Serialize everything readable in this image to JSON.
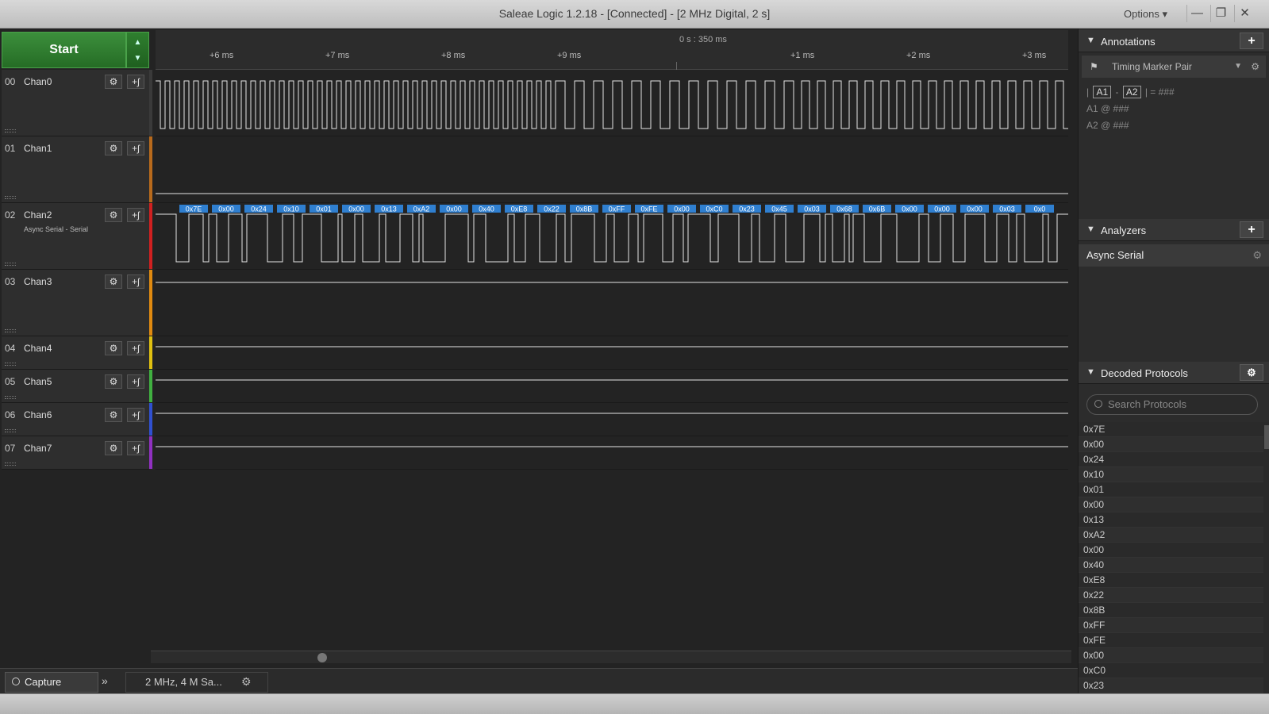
{
  "window": {
    "title": "Saleae Logic 1.2.18 - [Connected] - [2 MHz Digital, 2 s]",
    "options_label": "Options ▾",
    "minimize": "—",
    "restore": "❐",
    "close": "✕"
  },
  "toolbar": {
    "start_label": "Start",
    "start_arrows": [
      "▲",
      "▼"
    ]
  },
  "ruler": {
    "absolute_time": "0 s : 350 ms",
    "ticks": [
      "+6 ms",
      "+7 ms",
      "+8 ms",
      "+9 ms",
      "+1 ms",
      "+2 ms",
      "+3 ms"
    ]
  },
  "channels": [
    {
      "num": "00",
      "name": "Chan0",
      "sub": "",
      "color": "#3a3a3a"
    },
    {
      "num": "01",
      "name": "Chan1",
      "sub": "",
      "color": "#b86a1c"
    },
    {
      "num": "02",
      "name": "Chan2",
      "sub": "Async Serial - Serial",
      "color": "#d02020"
    },
    {
      "num": "03",
      "name": "Chan3",
      "sub": "",
      "color": "#e08a10"
    },
    {
      "num": "04",
      "name": "Chan4",
      "sub": "",
      "color": "#e0c010"
    },
    {
      "num": "05",
      "name": "Chan5",
      "sub": "",
      "color": "#40b040"
    },
    {
      "num": "06",
      "name": "Chan6",
      "sub": "",
      "color": "#3050d0"
    },
    {
      "num": "07",
      "name": "Chan7",
      "sub": "",
      "color": "#9030c0"
    }
  ],
  "channel_buttons": {
    "settings_icon": "⚙",
    "trigger_icon": "+ʃ"
  },
  "decoded_bubbles": [
    "0x7E",
    "0x00",
    "0x24",
    "0x10",
    "0x01",
    "0x00",
    "0x13",
    "0xA2",
    "0x00",
    "0x40",
    "0xE8",
    "0x22",
    "0x8B",
    "0xFF",
    "0xFE",
    "0x00",
    "0xC0",
    "0x23",
    "0x45",
    "0x03",
    "0x68",
    "0x6B",
    "0x00",
    "0x00",
    "0x00",
    "0x03",
    "0x0"
  ],
  "bottom": {
    "capture_label": "Capture",
    "chevron": "»",
    "rate_label": "2 MHz, 4 M Sa...",
    "gear": "⚙"
  },
  "annotations": {
    "header": "Annotations",
    "add": "+",
    "marker_label": "Timing Marker Pair",
    "line1_a1": "A1",
    "line1_a2": "A2",
    "line1_value": "= ###",
    "line2": "A1  @  ###",
    "line3": "A2  @  ###"
  },
  "analyzers": {
    "header": "Analyzers",
    "add": "+",
    "item": "Async Serial"
  },
  "decoded_protocols": {
    "header": "Decoded Protocols",
    "search_placeholder": "Search Protocols",
    "items": [
      "0x7E",
      "0x00",
      "0x24",
      "0x10",
      "0x01",
      "0x00",
      "0x13",
      "0xA2",
      "0x00",
      "0x40",
      "0xE8",
      "0x22",
      "0x8B",
      "0xFF",
      "0xFE",
      "0x00",
      "0xC0",
      "0x23"
    ]
  }
}
